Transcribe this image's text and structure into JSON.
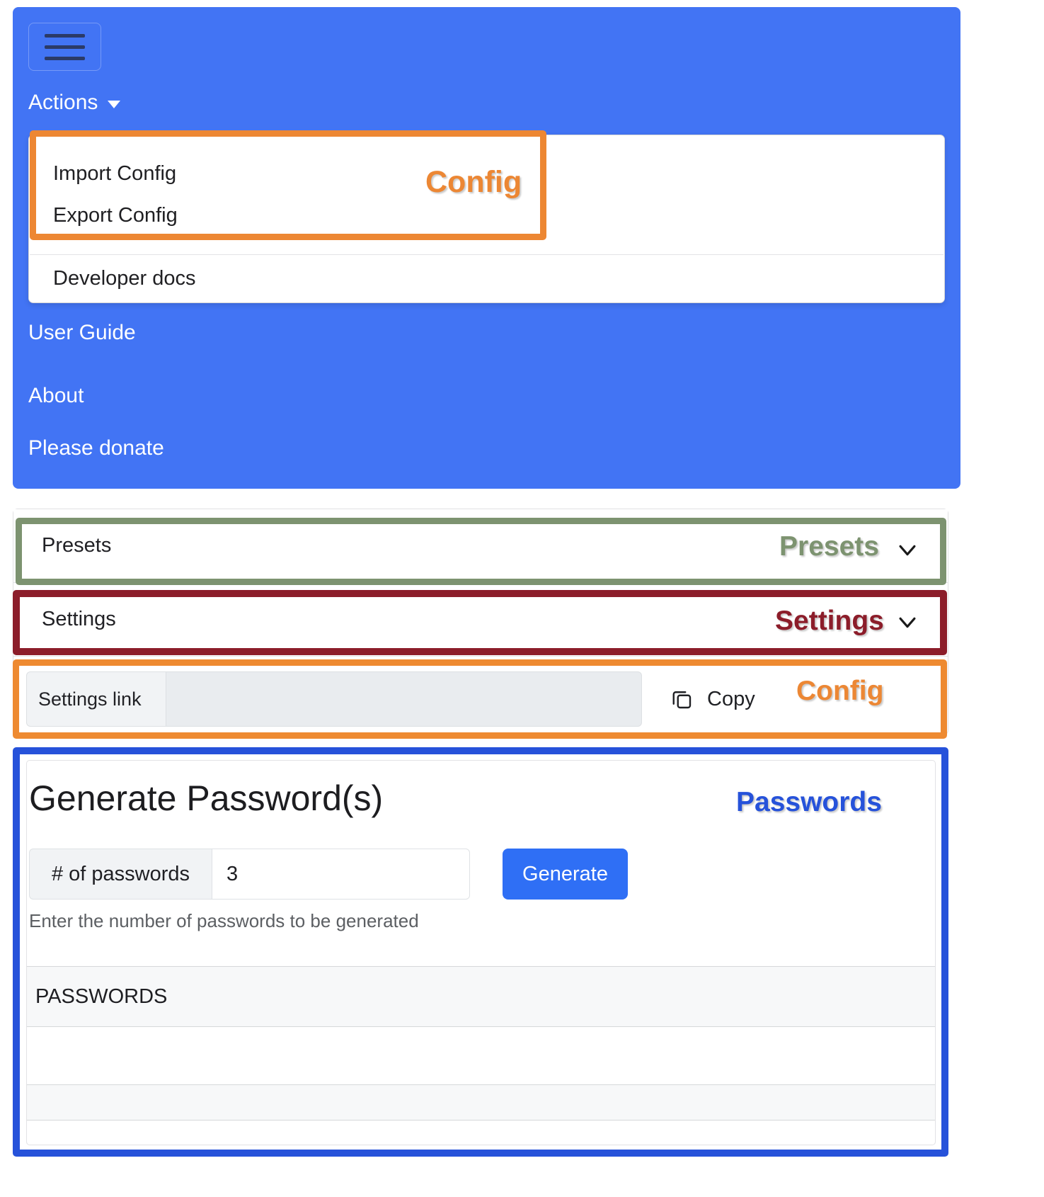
{
  "navbar": {
    "menu_button_icon": "hamburger-icon",
    "actions_label": "Actions",
    "dropdown_items": [
      {
        "label": "Import Config"
      },
      {
        "label": "Export Config"
      },
      {
        "label": "Developer docs"
      }
    ],
    "links": [
      {
        "label": "User Guide"
      },
      {
        "label": "About"
      },
      {
        "label": "Please donate"
      }
    ]
  },
  "accordion": {
    "presets_label": "Presets",
    "settings_label": "Settings",
    "chevron_icon": "chevron-down-icon"
  },
  "settings_link": {
    "addon_label": "Settings link",
    "value": "",
    "copy_label": "Copy",
    "copy_icon": "copy-icon"
  },
  "passwords": {
    "title": "Generate Password(s)",
    "count_addon_label": "# of passwords",
    "count_value": "3",
    "generate_label": "Generate",
    "help_text": "Enter the number of passwords to be generated",
    "table": {
      "header": "PASSWORDS",
      "rows": [
        "",
        ""
      ]
    }
  },
  "overlays": {
    "config_menu": "Config",
    "presets": "Presets",
    "settings": "Settings",
    "config_link": "Config",
    "passwords": "Passwords"
  },
  "colors": {
    "navbar_blue": "#4274f4",
    "highlight_orange": "#ec8734",
    "highlight_green": "#7d9370",
    "highlight_maroon": "#8c1d2a",
    "highlight_blue": "#2652da",
    "button_blue": "#2f6ff5"
  }
}
